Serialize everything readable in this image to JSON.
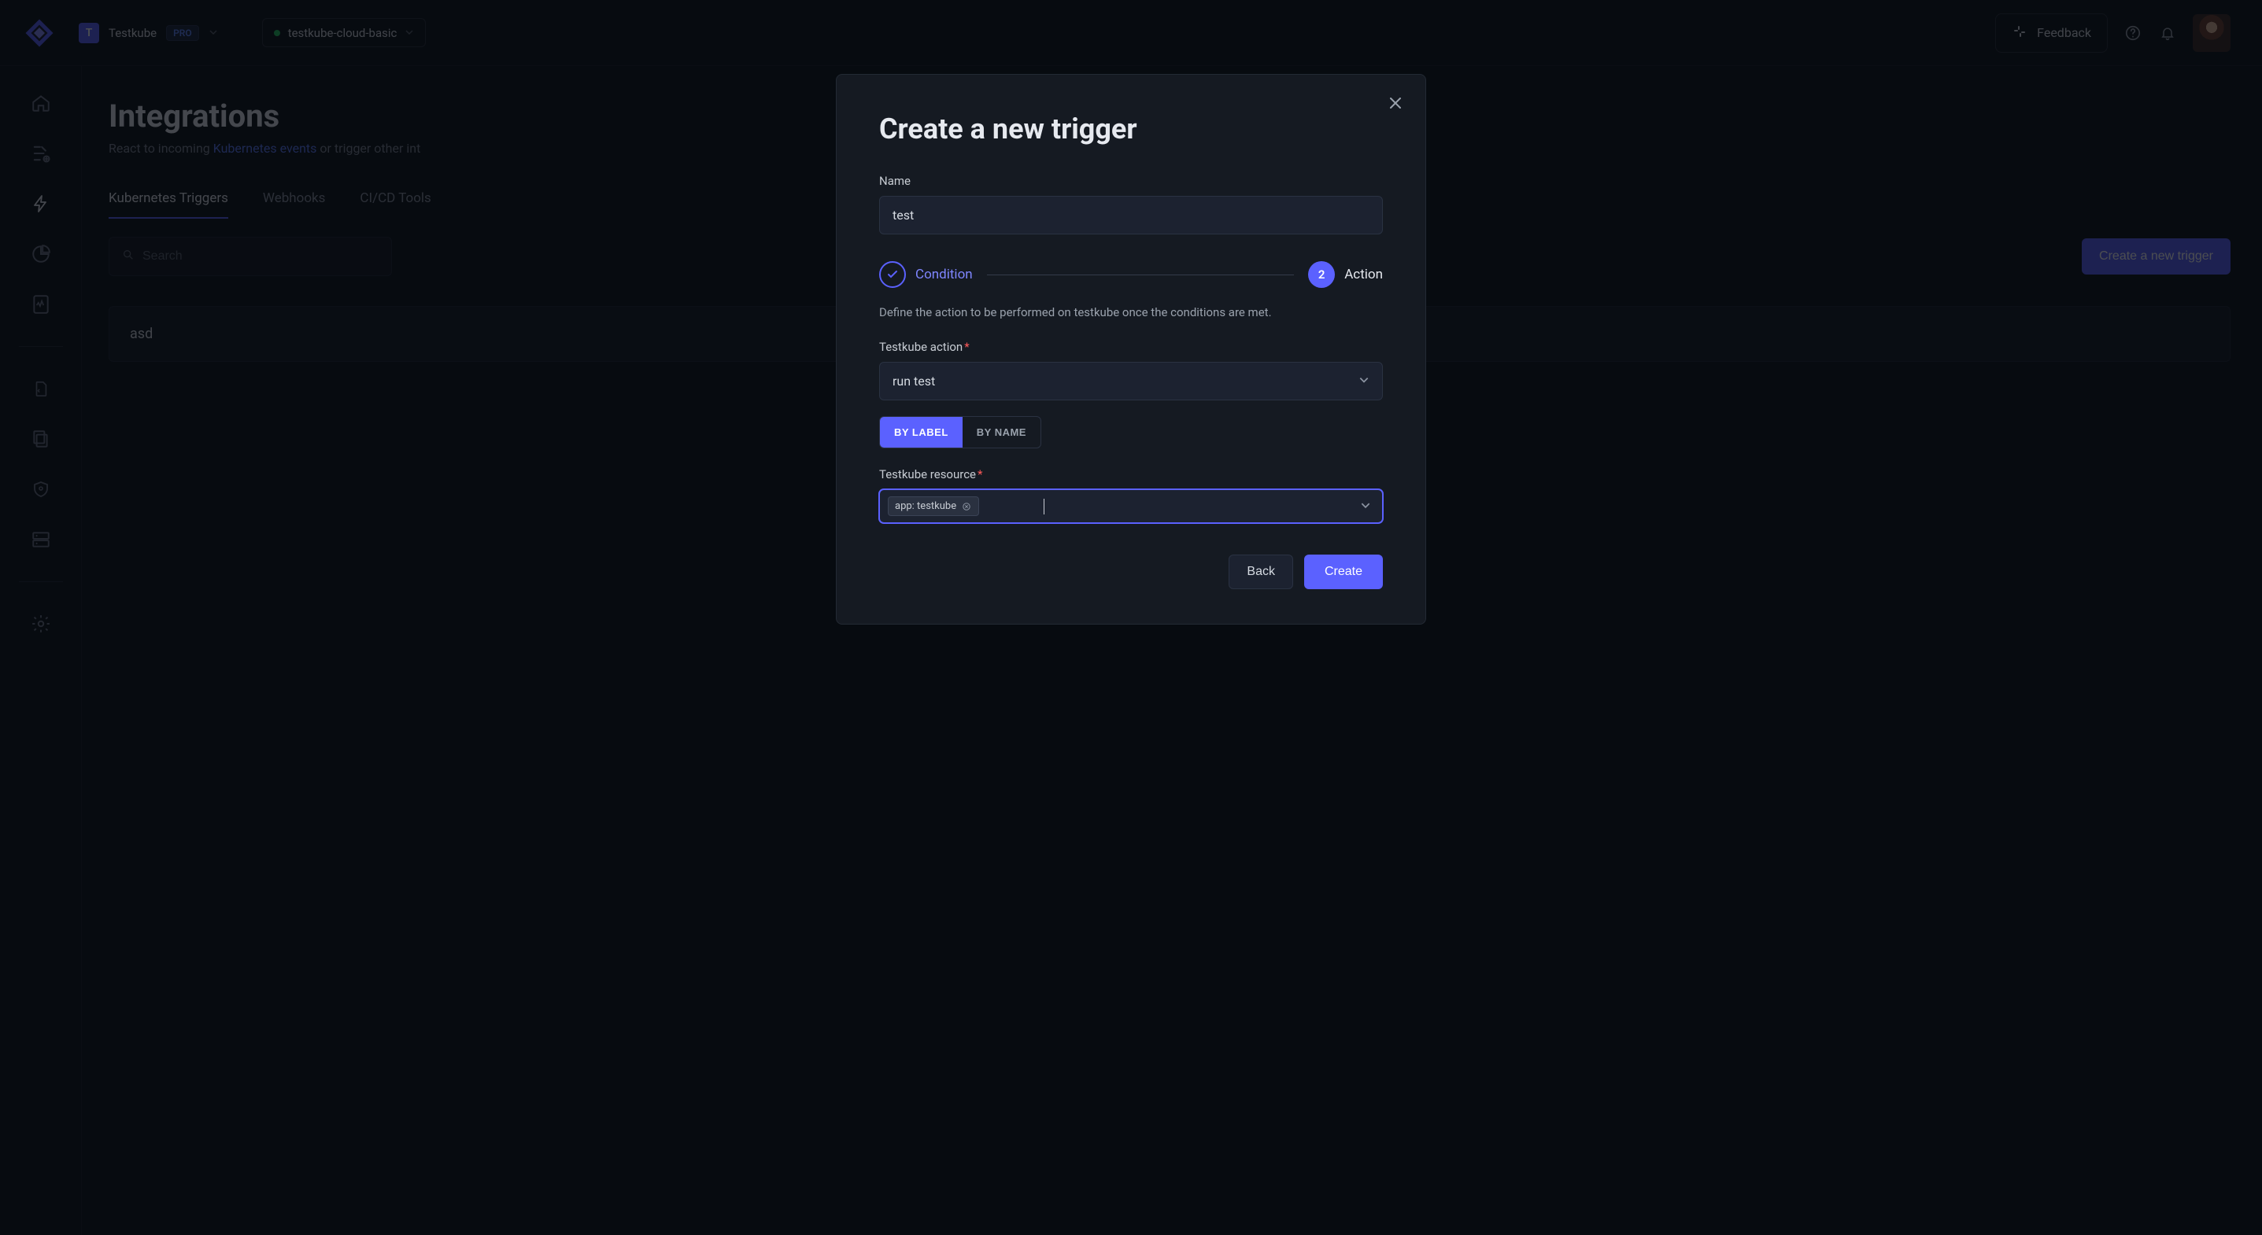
{
  "header": {
    "org_initial": "T",
    "org_name": "Testkube",
    "plan_badge": "PRO",
    "env_name": "testkube-cloud-basic",
    "feedback_label": "Feedback"
  },
  "page": {
    "title": "Integrations",
    "subtitle_prefix": "React to incoming ",
    "subtitle_link": "Kubernetes events",
    "subtitle_suffix": " or trigger other int",
    "tabs": [
      "Kubernetes Triggers",
      "Webhooks",
      "CI/CD Tools"
    ],
    "active_tab_index": 0,
    "search_placeholder": "Search",
    "create_button": "Create a new trigger",
    "list_items": [
      "asd"
    ]
  },
  "modal": {
    "title": "Create a new trigger",
    "name_label": "Name",
    "name_value": "test",
    "steps": {
      "condition_label": "Condition",
      "action_number": "2",
      "action_label": "Action"
    },
    "helper_text": "Define the action to be performed on testkube once the conditions are met.",
    "action_label": "Testkube action",
    "action_value": "run test",
    "segmented": [
      "BY LABEL",
      "BY NAME"
    ],
    "segmented_active_index": 0,
    "resource_label": "Testkube resource",
    "resource_tags": [
      "app: testkube"
    ],
    "back_label": "Back",
    "create_label": "Create"
  }
}
